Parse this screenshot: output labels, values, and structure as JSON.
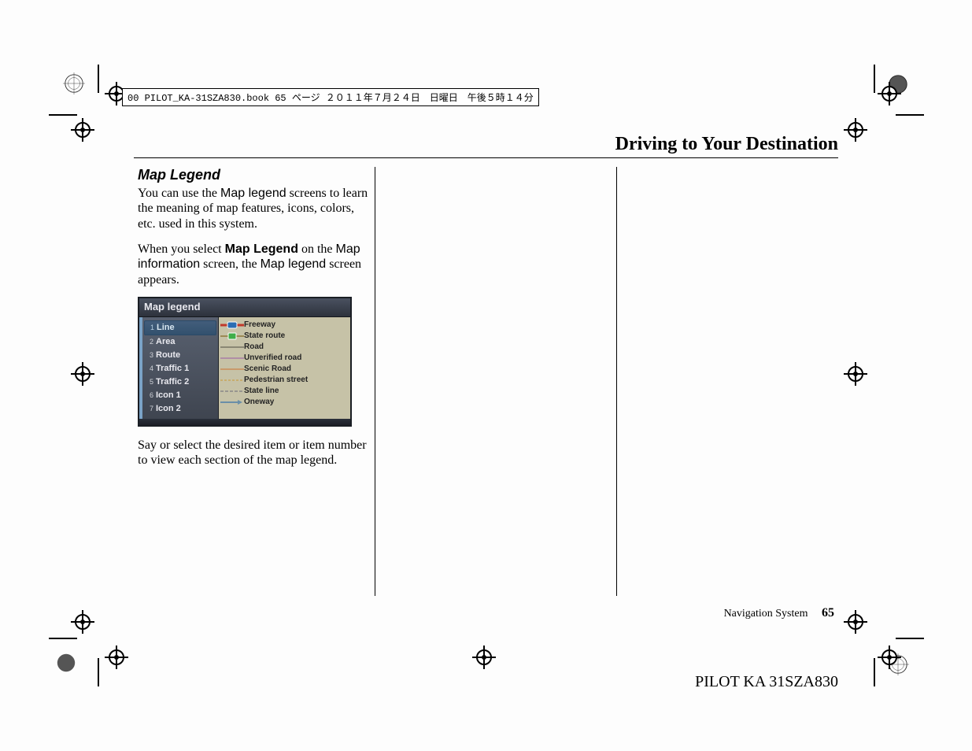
{
  "stamp": "00 PILOT_KA-31SZA830.book  65 ページ  ２０１１年７月２４日　日曜日　午後５時１４分",
  "chapter_title": "Driving to Your Destination",
  "section_heading": "Map Legend",
  "para1_a": "You can use the ",
  "para1_b": "Map legend",
  "para1_c": " screens to learn the meaning of map features, icons, colors, etc. used in this system.",
  "para2_a": "When you select ",
  "para2_b": "Map Legend",
  "para2_c": " on the ",
  "para2_d": "Map information",
  "para2_e": " screen, the ",
  "para2_f": "Map legend",
  "para2_g": " screen appears.",
  "screenshot_title": "Map legend",
  "legend_items": [
    {
      "n": "1",
      "label": "Line"
    },
    {
      "n": "2",
      "label": "Area"
    },
    {
      "n": "3",
      "label": "Route"
    },
    {
      "n": "4",
      "label": "Traffic 1"
    },
    {
      "n": "5",
      "label": "Traffic 2"
    },
    {
      "n": "6",
      "label": "Icon 1"
    },
    {
      "n": "7",
      "label": "Icon 2"
    }
  ],
  "detail_rows": [
    "Freeway",
    "State route",
    "Road",
    "Unverified road",
    "Scenic Road",
    "Pedestrian street",
    "State line",
    "Oneway"
  ],
  "para3": "Say or select the desired item or item number to view each section of the map legend.",
  "footer_label": "Navigation System",
  "footer_page": "65",
  "doc_code": "PILOT KA  31SZA830"
}
